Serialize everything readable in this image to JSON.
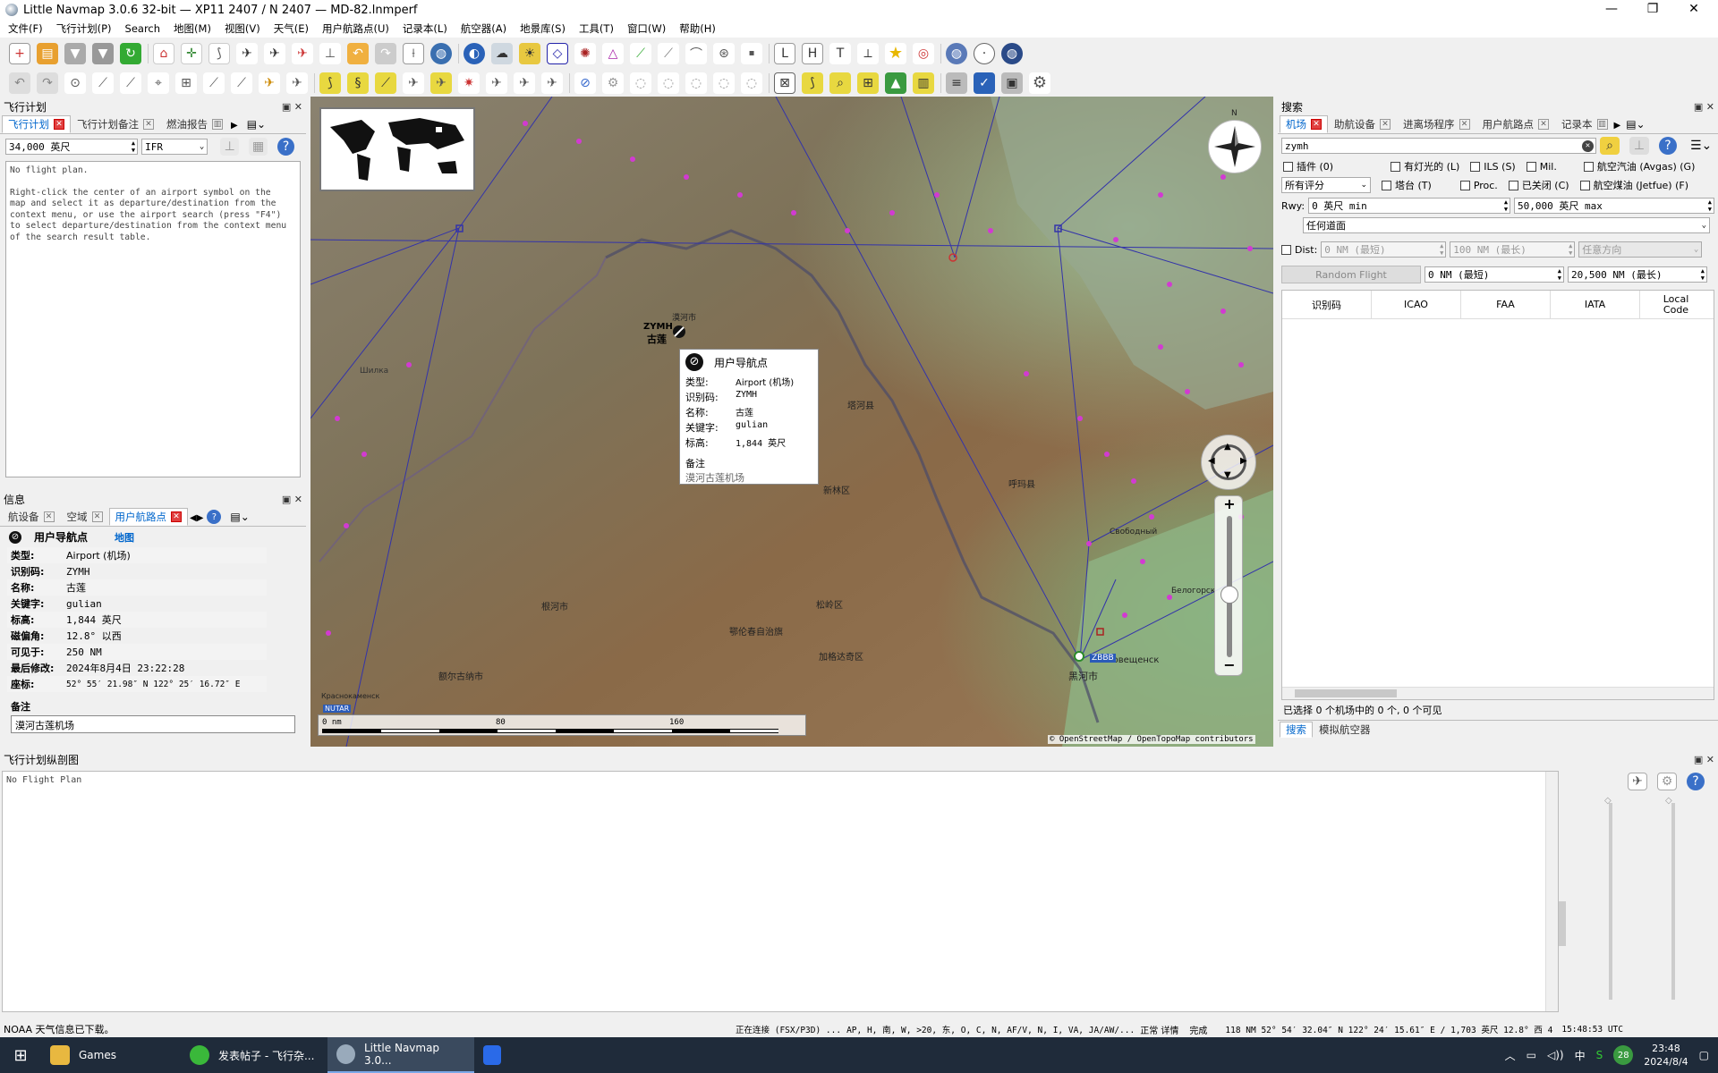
{
  "window": {
    "title": "Little Navmap 3.0.6 32-bit — XP11 2407 / N 2407 — MD-82.lnmperf",
    "minimize": "—",
    "maximize": "❐",
    "close": "✕"
  },
  "menu": [
    "文件(F)",
    "飞行计划(P)",
    "Search",
    "地图(M)",
    "视图(V)",
    "天气(E)",
    "用户航路点(U)",
    "记录本(L)",
    "航空器(A)",
    "地景库(S)",
    "工具(T)",
    "窗口(W)",
    "帮助(H)"
  ],
  "colors": {
    "accent": "#06c",
    "tab_close": "#e04040",
    "map_water": "#a7c7a0",
    "airspace_line": "#3333aa",
    "waypoint": "#d23ad2"
  },
  "flight_plan_panel": {
    "title": "飞行计划",
    "tabs": [
      "飞行计划",
      "飞行计划备注",
      "燃油报告"
    ],
    "altitude": "34,000 英尺",
    "flight_type": "IFR",
    "text_lines": [
      "No flight plan.",
      "",
      "Right-click the center of an airport symbol on the",
      "map and select it as departure/destination from the",
      "context menu, or use the airport search (press \"F4\")",
      "to select departure/destination from the context menu",
      "of the search result table."
    ]
  },
  "info_panel": {
    "title": "信息",
    "tabs": [
      "航设备",
      "空域",
      "用户航路点"
    ],
    "heading": "用户导航点",
    "map_link": "地图",
    "rows": [
      {
        "k": "类型:",
        "v": "Airport (机场)"
      },
      {
        "k": "识别码:",
        "v": "ZYMH"
      },
      {
        "k": "名称:",
        "v": "古莲"
      },
      {
        "k": "关键字:",
        "v": "gulian"
      },
      {
        "k": "标高:",
        "v": "1,844 英尺"
      },
      {
        "k": "磁偏角:",
        "v": "12.8° 以西"
      },
      {
        "k": "可见于:",
        "v": "250 NM"
      },
      {
        "k": "最后修改:",
        "v": "2024年8月4日 23:22:28"
      },
      {
        "k": "座标:",
        "v": "52° 55′ 21.98″ N 122° 25′ 16.72″ E"
      }
    ],
    "remarks_label": "备注",
    "remarks": "漠河古莲机场"
  },
  "map": {
    "tooltip": {
      "title": "用户导航点",
      "rows": [
        {
          "k": "类型:",
          "v": "Airport (机场)"
        },
        {
          "k": "识别码:",
          "v": "ZYMH"
        },
        {
          "k": "名称:",
          "v": "古莲"
        },
        {
          "k": "关键字:",
          "v": "gulian"
        },
        {
          "k": "标高:",
          "v": "1,844 英尺"
        }
      ],
      "remarks_label": "备注",
      "remarks": "漠河古莲机场"
    },
    "labels": {
      "zymh": "ZYMH",
      "gulian": "古莲",
      "mohe": "漠河市",
      "tahe": "塔河县",
      "xinlin": "新林区",
      "huma": "呼玛县",
      "songling": "松岭区",
      "jiagedaqi": "加格达奇区",
      "genhe": "根河市",
      "ergun": "额尔古纳市",
      "oroqen": "鄂伦春自治旗",
      "heihe": "黑河市",
      "zbbb": "ZBBB",
      "blag": "Благовещенск",
      "svob": "Свободный",
      "belog": "Белогорск",
      "shilka": "Шилка",
      "krasno": "Краснокаменск",
      "nutar": "NUTAR"
    },
    "scale": {
      "labels": [
        "0 nm",
        "80",
        "160"
      ]
    },
    "attribution": "© OpenStreetMap / OpenTopoMap contributors",
    "zoom_plus": "+",
    "zoom_minus": "−",
    "compass_n": "N"
  },
  "search_panel": {
    "title": "搜索",
    "tabs": [
      "机场",
      "助航设备",
      "进离场程序",
      "用户航路点",
      "记录本"
    ],
    "query": "zymh",
    "checkbox_row1": [
      "插件 (0)",
      "有灯光的 (L)",
      "ILS (S)",
      "Mil.",
      "航空汽油 (Avgas) (G)"
    ],
    "rating": "所有评分",
    "checkbox_row2": [
      "塔台 (T)",
      "Proc.",
      "已关闭 (C)",
      "航空煤油 (Jetfue) (F)"
    ],
    "rwy_label": "Rwy:",
    "rwy_min": "0 英尺 min",
    "rwy_max": "50,000 英尺 max",
    "surface": "任何道面",
    "dist_label": "Dist:",
    "dist_min": "0 NM (最短)",
    "dist_max": "100 NM (最长)",
    "direction": "任意方向",
    "random_flight": "Random Flight",
    "rf_min": "0 NM (最短)",
    "rf_max": "20,500 NM (最长)",
    "columns": [
      "识别码",
      "ICAO",
      "FAA",
      "IATA",
      "Local Code"
    ],
    "status": "已选择 0 个机场中的 0 个, 0 个可见",
    "bottom_tabs": [
      "搜索",
      "模拟航空器"
    ]
  },
  "profile_panel": {
    "title": "飞行计划纵剖图",
    "text": "No Flight Plan"
  },
  "statusbar": {
    "left": "NOAA 天气信息已下载。",
    "connection": "正在连接 (FSX/P3D) ...",
    "layers": "AP, H, 南, W, >20, 东, O, C, N, AF/V, N, I, VA, JA/AW/...",
    "mode": "正常 详情",
    "done": "完成",
    "position": "118 NM  52° 54′ 32.04″ N 122° 24′ 15.61″ E / 1,703 英尺 12.8° 西 4",
    "time": "15:48:53 UTC"
  },
  "taskbar": {
    "items": [
      "Games",
      "发表帖子 - 飞行杂...",
      "Little Navmap 3.0..."
    ],
    "clock_time": "23:48",
    "clock_date": "2024/8/4",
    "ime": "中",
    "badge": "28"
  }
}
